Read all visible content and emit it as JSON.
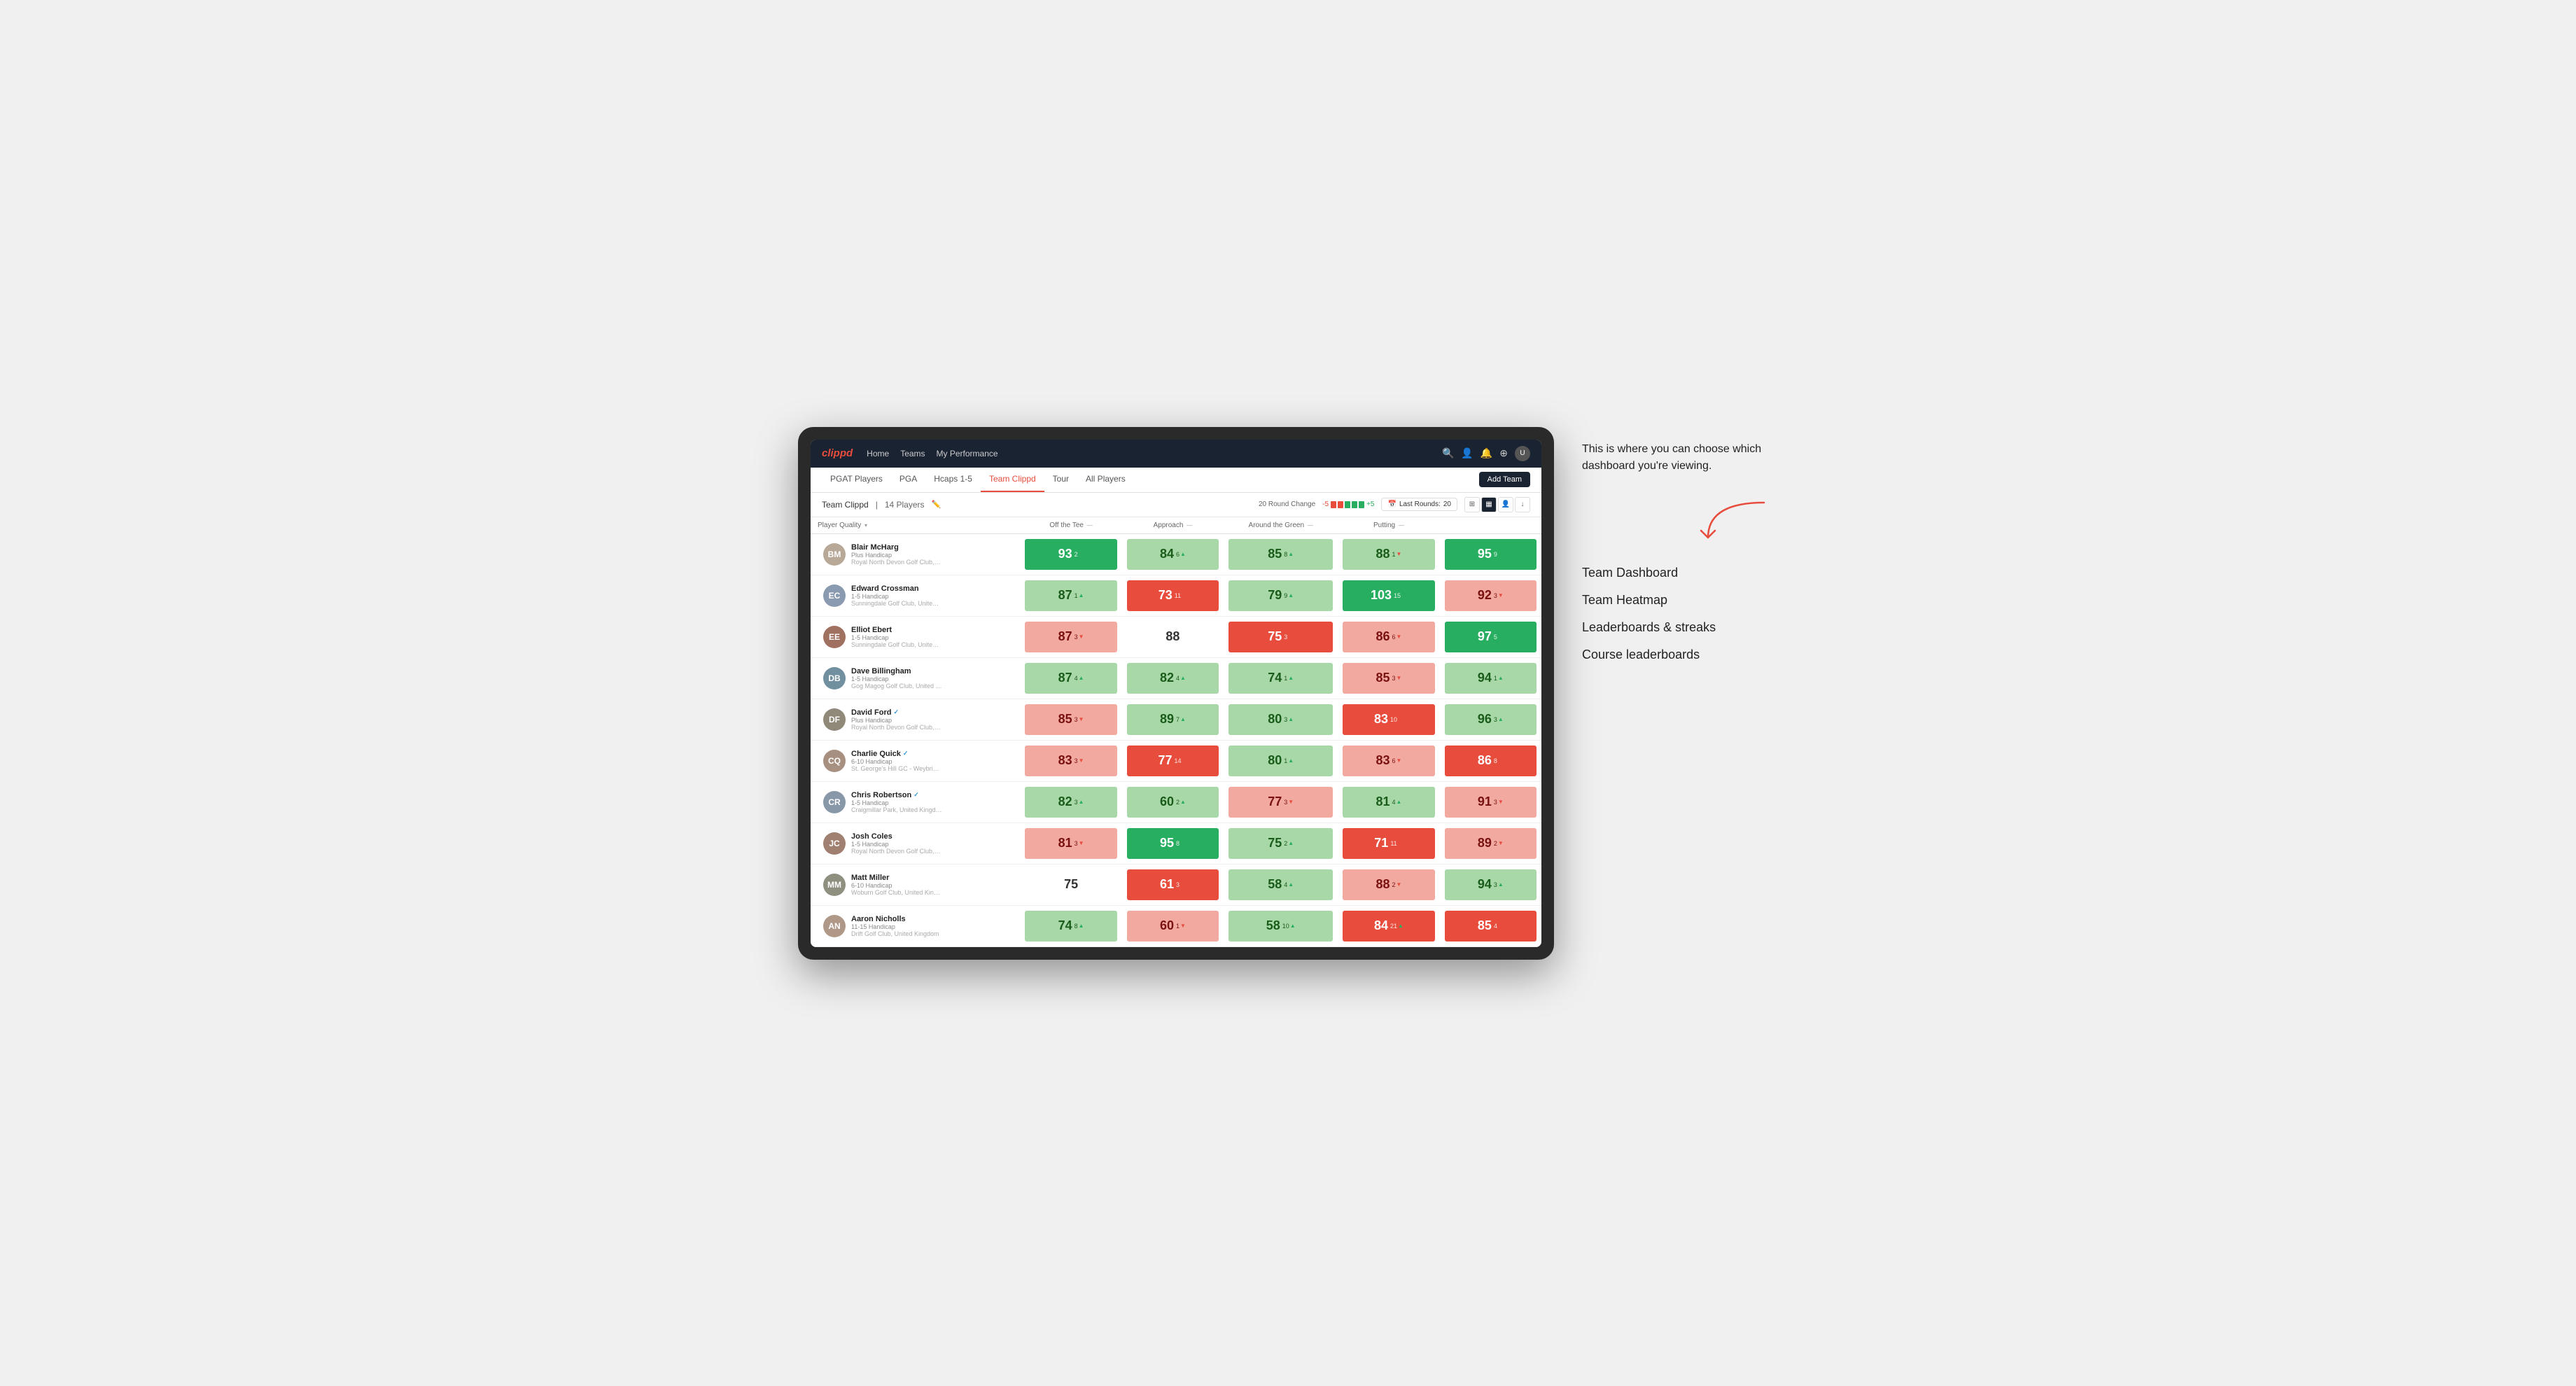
{
  "annotation": {
    "intro": "This is where you can choose which dashboard you're viewing.",
    "links": [
      "Team Dashboard",
      "Team Heatmap",
      "Leaderboards & streaks",
      "Course leaderboards"
    ]
  },
  "nav": {
    "logo": "clippd",
    "links": [
      "Home",
      "Teams",
      "My Performance"
    ],
    "icons": [
      "search",
      "user",
      "bell",
      "circle-plus",
      "avatar"
    ]
  },
  "tabs": {
    "items": [
      "PGAT Players",
      "PGA",
      "Hcaps 1-5",
      "Team Clippd",
      "Tour",
      "All Players"
    ],
    "active": "Team Clippd",
    "add_button": "Add Team"
  },
  "team_bar": {
    "name": "Team Clippd",
    "separator": "|",
    "count": "14 Players",
    "round_change_label": "20 Round Change",
    "change_neg": "-5",
    "change_pos": "+5",
    "last_rounds_label": "Last Rounds:",
    "last_rounds_value": "20"
  },
  "table": {
    "headers": {
      "player": "Player Quality",
      "off_tee": "Off the Tee",
      "approach": "Approach",
      "around_green": "Around the Green",
      "putting": "Putting"
    },
    "players": [
      {
        "name": "Blair McHarg",
        "handicap": "Plus Handicap",
        "club": "Royal North Devon Golf Club, United Kingdom",
        "verified": false,
        "scores": {
          "player_quality": {
            "value": 93,
            "change": 2,
            "dir": "up",
            "color": "bg-dark-green"
          },
          "off_tee": {
            "value": 84,
            "change": 6,
            "dir": "up",
            "color": "bg-light-green"
          },
          "approach": {
            "value": 85,
            "change": 8,
            "dir": "up",
            "color": "bg-light-green"
          },
          "around_green": {
            "value": 88,
            "change": 1,
            "dir": "down",
            "color": "bg-light-green"
          },
          "putting": {
            "value": 95,
            "change": 9,
            "dir": "up",
            "color": "bg-dark-green"
          }
        }
      },
      {
        "name": "Edward Crossman",
        "handicap": "1-5 Handicap",
        "club": "Sunningdale Golf Club, United Kingdom",
        "verified": false,
        "scores": {
          "player_quality": {
            "value": 87,
            "change": 1,
            "dir": "up",
            "color": "bg-light-green"
          },
          "off_tee": {
            "value": 73,
            "change": 11,
            "dir": "down",
            "color": "bg-red"
          },
          "approach": {
            "value": 79,
            "change": 9,
            "dir": "up",
            "color": "bg-light-green"
          },
          "around_green": {
            "value": 103,
            "change": 15,
            "dir": "up",
            "color": "bg-dark-green"
          },
          "putting": {
            "value": 92,
            "change": 3,
            "dir": "down",
            "color": "bg-light-red"
          }
        }
      },
      {
        "name": "Elliot Ebert",
        "handicap": "1-5 Handicap",
        "club": "Sunningdale Golf Club, United Kingdom",
        "verified": false,
        "scores": {
          "player_quality": {
            "value": 87,
            "change": 3,
            "dir": "down",
            "color": "bg-light-red"
          },
          "off_tee": {
            "value": 88,
            "change": 0,
            "dir": "none",
            "color": "bg-white"
          },
          "approach": {
            "value": 75,
            "change": 3,
            "dir": "down",
            "color": "bg-red"
          },
          "around_green": {
            "value": 86,
            "change": 6,
            "dir": "down",
            "color": "bg-light-red"
          },
          "putting": {
            "value": 97,
            "change": 5,
            "dir": "up",
            "color": "bg-dark-green"
          }
        }
      },
      {
        "name": "Dave Billingham",
        "handicap": "1-5 Handicap",
        "club": "Gog Magog Golf Club, United Kingdom",
        "verified": false,
        "scores": {
          "player_quality": {
            "value": 87,
            "change": 4,
            "dir": "up",
            "color": "bg-light-green"
          },
          "off_tee": {
            "value": 82,
            "change": 4,
            "dir": "up",
            "color": "bg-light-green"
          },
          "approach": {
            "value": 74,
            "change": 1,
            "dir": "up",
            "color": "bg-light-green"
          },
          "around_green": {
            "value": 85,
            "change": 3,
            "dir": "down",
            "color": "bg-light-red"
          },
          "putting": {
            "value": 94,
            "change": 1,
            "dir": "up",
            "color": "bg-light-green"
          }
        }
      },
      {
        "name": "David Ford",
        "handicap": "Plus Handicap",
        "club": "Royal North Devon Golf Club, United Kingdom",
        "verified": true,
        "scores": {
          "player_quality": {
            "value": 85,
            "change": 3,
            "dir": "down",
            "color": "bg-light-red"
          },
          "off_tee": {
            "value": 89,
            "change": 7,
            "dir": "up",
            "color": "bg-light-green"
          },
          "approach": {
            "value": 80,
            "change": 3,
            "dir": "up",
            "color": "bg-light-green"
          },
          "around_green": {
            "value": 83,
            "change": 10,
            "dir": "down",
            "color": "bg-red"
          },
          "putting": {
            "value": 96,
            "change": 3,
            "dir": "up",
            "color": "bg-light-green"
          }
        }
      },
      {
        "name": "Charlie Quick",
        "handicap": "6-10 Handicap",
        "club": "St. George's Hill GC - Weybridge - Surrey, Uni...",
        "verified": true,
        "scores": {
          "player_quality": {
            "value": 83,
            "change": 3,
            "dir": "down",
            "color": "bg-light-red"
          },
          "off_tee": {
            "value": 77,
            "change": 14,
            "dir": "down",
            "color": "bg-red"
          },
          "approach": {
            "value": 80,
            "change": 1,
            "dir": "up",
            "color": "bg-light-green"
          },
          "around_green": {
            "value": 83,
            "change": 6,
            "dir": "down",
            "color": "bg-light-red"
          },
          "putting": {
            "value": 86,
            "change": 8,
            "dir": "down",
            "color": "bg-red"
          }
        }
      },
      {
        "name": "Chris Robertson",
        "handicap": "1-5 Handicap",
        "club": "Craigmillar Park, United Kingdom",
        "verified": true,
        "scores": {
          "player_quality": {
            "value": 82,
            "change": 3,
            "dir": "up",
            "color": "bg-light-green"
          },
          "off_tee": {
            "value": 60,
            "change": 2,
            "dir": "up",
            "color": "bg-light-green"
          },
          "approach": {
            "value": 77,
            "change": 3,
            "dir": "down",
            "color": "bg-light-red"
          },
          "around_green": {
            "value": 81,
            "change": 4,
            "dir": "up",
            "color": "bg-light-green"
          },
          "putting": {
            "value": 91,
            "change": 3,
            "dir": "down",
            "color": "bg-light-red"
          }
        }
      },
      {
        "name": "Josh Coles",
        "handicap": "1-5 Handicap",
        "club": "Royal North Devon Golf Club, United Kingdom",
        "verified": false,
        "scores": {
          "player_quality": {
            "value": 81,
            "change": 3,
            "dir": "down",
            "color": "bg-light-red"
          },
          "off_tee": {
            "value": 95,
            "change": 8,
            "dir": "up",
            "color": "bg-dark-green"
          },
          "approach": {
            "value": 75,
            "change": 2,
            "dir": "up",
            "color": "bg-light-green"
          },
          "around_green": {
            "value": 71,
            "change": 11,
            "dir": "down",
            "color": "bg-red"
          },
          "putting": {
            "value": 89,
            "change": 2,
            "dir": "down",
            "color": "bg-light-red"
          }
        }
      },
      {
        "name": "Matt Miller",
        "handicap": "6-10 Handicap",
        "club": "Woburn Golf Club, United Kingdom",
        "verified": false,
        "scores": {
          "player_quality": {
            "value": 75,
            "change": 0,
            "dir": "none",
            "color": "bg-white"
          },
          "off_tee": {
            "value": 61,
            "change": 3,
            "dir": "down",
            "color": "bg-red"
          },
          "approach": {
            "value": 58,
            "change": 4,
            "dir": "up",
            "color": "bg-light-green"
          },
          "around_green": {
            "value": 88,
            "change": 2,
            "dir": "down",
            "color": "bg-light-red"
          },
          "putting": {
            "value": 94,
            "change": 3,
            "dir": "up",
            "color": "bg-light-green"
          }
        }
      },
      {
        "name": "Aaron Nicholls",
        "handicap": "11-15 Handicap",
        "club": "Drift Golf Club, United Kingdom",
        "verified": false,
        "scores": {
          "player_quality": {
            "value": 74,
            "change": 8,
            "dir": "up",
            "color": "bg-light-green"
          },
          "off_tee": {
            "value": 60,
            "change": 1,
            "dir": "down",
            "color": "bg-light-red"
          },
          "approach": {
            "value": 58,
            "change": 10,
            "dir": "up",
            "color": "bg-light-green"
          },
          "around_green": {
            "value": 84,
            "change": 21,
            "dir": "up",
            "color": "bg-red"
          },
          "putting": {
            "value": 85,
            "change": 4,
            "dir": "down",
            "color": "bg-red"
          }
        }
      }
    ]
  }
}
